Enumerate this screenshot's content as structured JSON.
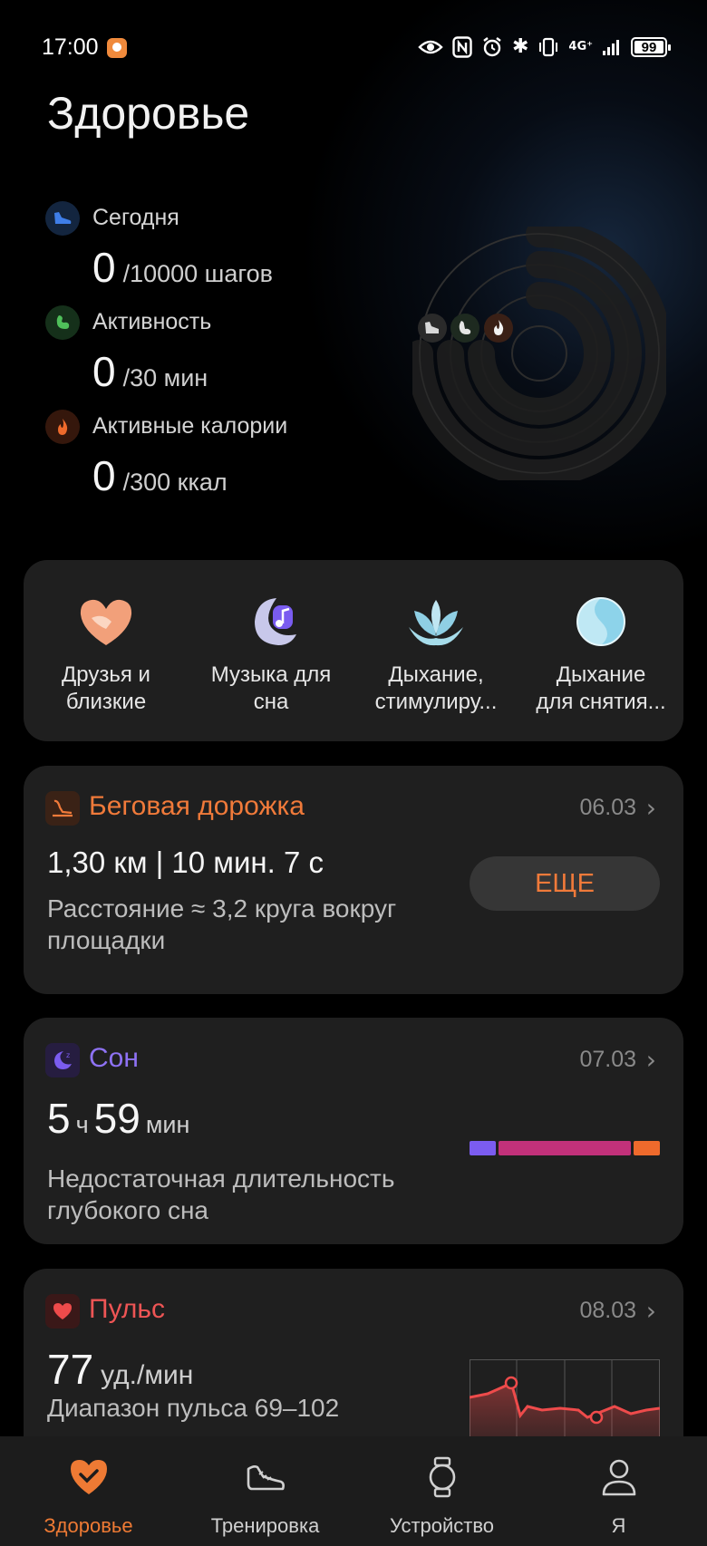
{
  "status_bar": {
    "time": "17:00",
    "network": "4G⁺",
    "battery": "99"
  },
  "page": {
    "title": "Здоровье"
  },
  "metrics": [
    {
      "label": "Сегодня",
      "value": "0",
      "goal": "/10000 шагов",
      "icon": "shoe-icon",
      "color": "#3f7ee8"
    },
    {
      "label": "Активность",
      "value": "0",
      "goal": "/30 мин",
      "icon": "flexed-arm-icon",
      "color": "#4fbf5a"
    },
    {
      "label": "Активные калории",
      "value": "0",
      "goal": "/300 ккал",
      "icon": "flame-icon",
      "color": "#ee6a2c"
    }
  ],
  "shortcuts": [
    {
      "label_line1": "Друзья и",
      "label_line2": "близкие",
      "icon": "heart-hands-icon"
    },
    {
      "label_line1": "Музыка для",
      "label_line2": "сна",
      "icon": "moon-music-icon"
    },
    {
      "label_line1": "Дыхание,",
      "label_line2": "стимулиру...",
      "icon": "lotus-icon"
    },
    {
      "label_line1": "Дыхание",
      "label_line2": "для снятия...",
      "icon": "yin-orb-icon"
    }
  ],
  "treadmill": {
    "title": "Беговая дорожка",
    "date": "06.03",
    "main": "1,30 км | 10 мин. 7 с",
    "sub_line1": "Расстояние ≈ 3,2 круга вокруг",
    "sub_line2": "площадки",
    "button": "ЕЩЕ",
    "accent": "#f07a3a"
  },
  "sleep": {
    "title": "Сон",
    "date": "07.03",
    "hours": "5",
    "hours_unit": "ч",
    "minutes": "59",
    "minutes_unit": "мин",
    "sub_line1": "Недостаточная длительность",
    "sub_line2": "глубокого сна",
    "accent": "#7b5cf0",
    "stages": [
      {
        "name": "deep",
        "fraction": 0.14,
        "color": "#7b5cf0"
      },
      {
        "name": "light",
        "fraction": 0.72,
        "color": "#c2317a"
      },
      {
        "name": "rem",
        "fraction": 0.14,
        "color": "#ee6a2c"
      }
    ]
  },
  "pulse": {
    "title": "Пульс",
    "date": "08.03",
    "value": "77",
    "unit": "уд./мин",
    "range": "Диапазон пульса 69–102",
    "accent": "#ee4b4b"
  },
  "nav": [
    {
      "label": "Здоровье",
      "icon": "heart-check-icon",
      "active": true
    },
    {
      "label": "Тренировка",
      "icon": "sneaker-icon",
      "active": false
    },
    {
      "label": "Устройство",
      "icon": "watch-icon",
      "active": false
    },
    {
      "label": "Я",
      "icon": "person-icon",
      "active": false
    }
  ]
}
